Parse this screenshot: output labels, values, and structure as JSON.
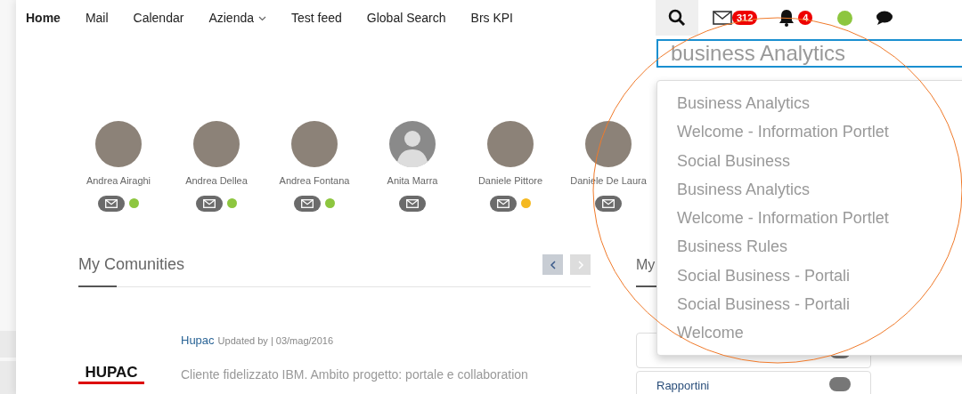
{
  "nav": {
    "items": [
      {
        "label": "Home",
        "selected": true,
        "kind": "link"
      },
      {
        "label": "Mail",
        "selected": false,
        "kind": "link"
      },
      {
        "label": "Calendar",
        "selected": false,
        "kind": "link"
      },
      {
        "label": "Azienda",
        "selected": false,
        "kind": "dropdown"
      },
      {
        "label": "Test feed",
        "selected": false,
        "kind": "link"
      },
      {
        "label": "Global Search",
        "selected": false,
        "kind": "link"
      },
      {
        "label": "Brs KPI",
        "selected": false,
        "kind": "link"
      }
    ],
    "mail_count": "312",
    "notification_count": "4",
    "presence_online": true
  },
  "search": {
    "value": "business Analytics",
    "suggestions": [
      "Business Analytics",
      "Welcome - Information Portlet",
      "Social Business",
      "Business Analytics",
      "Welcome - Information Portlet",
      "Business Rules",
      "Social Business - Portali",
      "Social Business - Portali",
      "Welcome"
    ]
  },
  "people": [
    {
      "name": "Andrea Airaghi",
      "kind": "photo",
      "color": "#8dc63f"
    },
    {
      "name": "Andrea Dellea",
      "kind": "photo",
      "color": "#8dc63f"
    },
    {
      "name": "Andrea Fontana",
      "kind": "photo",
      "color": "#8dc63f"
    },
    {
      "name": "Anita Marra",
      "kind": "silhouette"
    },
    {
      "name": "Daniele Pittore",
      "kind": "photo",
      "color": "#f5b921"
    },
    {
      "name": "Daniele De Laura",
      "kind": "photo"
    }
  ],
  "communities": {
    "title": "My Comunities",
    "prev_disabled": false,
    "next_disabled": true,
    "items": [
      {
        "name": "Hupac",
        "logo_text": "HUPAC",
        "meta": "Updated by | 03/mag/2016",
        "description": "Cliente fidelizzato IBM. Ambito progetto: portale e collaboration"
      }
    ]
  },
  "side_panel": {
    "title": "My",
    "items": [
      {
        "kind": "blank"
      },
      {
        "kind": "labeled",
        "label": "Rapportini"
      }
    ]
  }
}
